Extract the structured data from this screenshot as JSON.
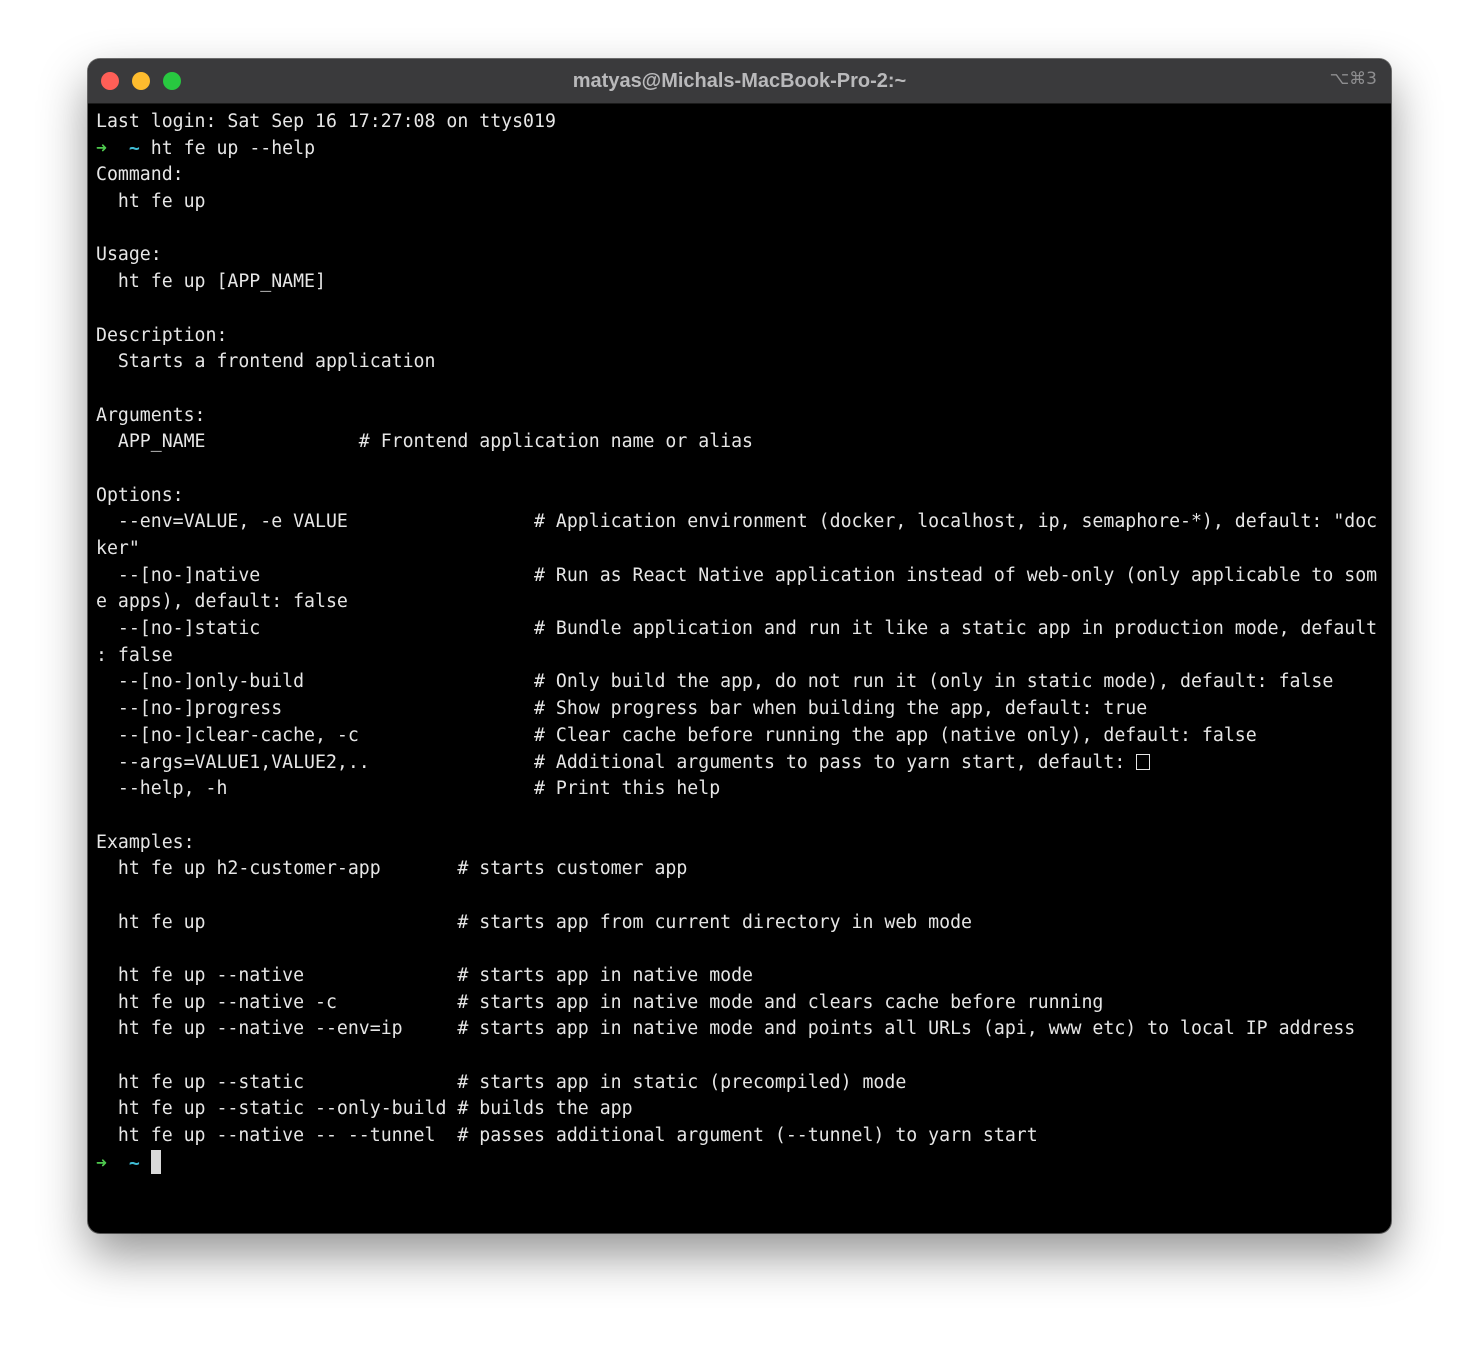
{
  "window": {
    "title": "matyas@Michals-MacBook-Pro-2:~",
    "shortcut": "⌥⌘3"
  },
  "terminal": {
    "prompt_arrow": "➜",
    "prompt_dir": "~",
    "last_login": "Last login: Sat Sep 16 17:27:08 on ttys019",
    "command": "ht fe up --help",
    "command_header": "Command:",
    "command_text": "  ht fe up",
    "usage_header": "Usage:",
    "usage_text": "  ht fe up [APP_NAME]",
    "description_header": "Description:",
    "description_text": "  Starts a frontend application",
    "arguments_header": "Arguments:",
    "arguments": [
      "  APP_NAME              # Frontend application name or alias"
    ],
    "options_header": "Options:",
    "options_lines": [
      "  --env=VALUE, -e VALUE                 # Application environment (docker, localhost, ip, semaphore-*), default: \"doc",
      "ker\"",
      "  --[no-]native                         # Run as React Native application instead of web-only (only applicable to som",
      "e apps), default: false",
      "  --[no-]static                         # Bundle application and run it like a static app in production mode, default",
      ": false",
      "  --[no-]only-build                     # Only build the app, do not run it (only in static mode), default: false",
      "  --[no-]progress                       # Show progress bar when building the app, default: true",
      "  --[no-]clear-cache, -c                # Clear cache before running the app (native only), default: false",
      "  --args=VALUE1,VALUE2,..               # Additional arguments to pass to yarn start, default: ",
      "  --help, -h                            # Print this help"
    ],
    "examples_header": "Examples:",
    "examples_lines": [
      "  ht fe up h2-customer-app       # starts customer app",
      "",
      "  ht fe up                       # starts app from current directory in web mode",
      "",
      "  ht fe up --native              # starts app in native mode",
      "  ht fe up --native -c           # starts app in native mode and clears cache before running",
      "  ht fe up --native --env=ip     # starts app in native mode and points all URLs (api, www etc) to local IP address",
      "",
      "  ht fe up --static              # starts app in static (precompiled) mode",
      "  ht fe up --static --only-build # builds the app",
      "  ht fe up --native -- --tunnel  # passes additional argument (--tunnel) to yarn start"
    ]
  }
}
